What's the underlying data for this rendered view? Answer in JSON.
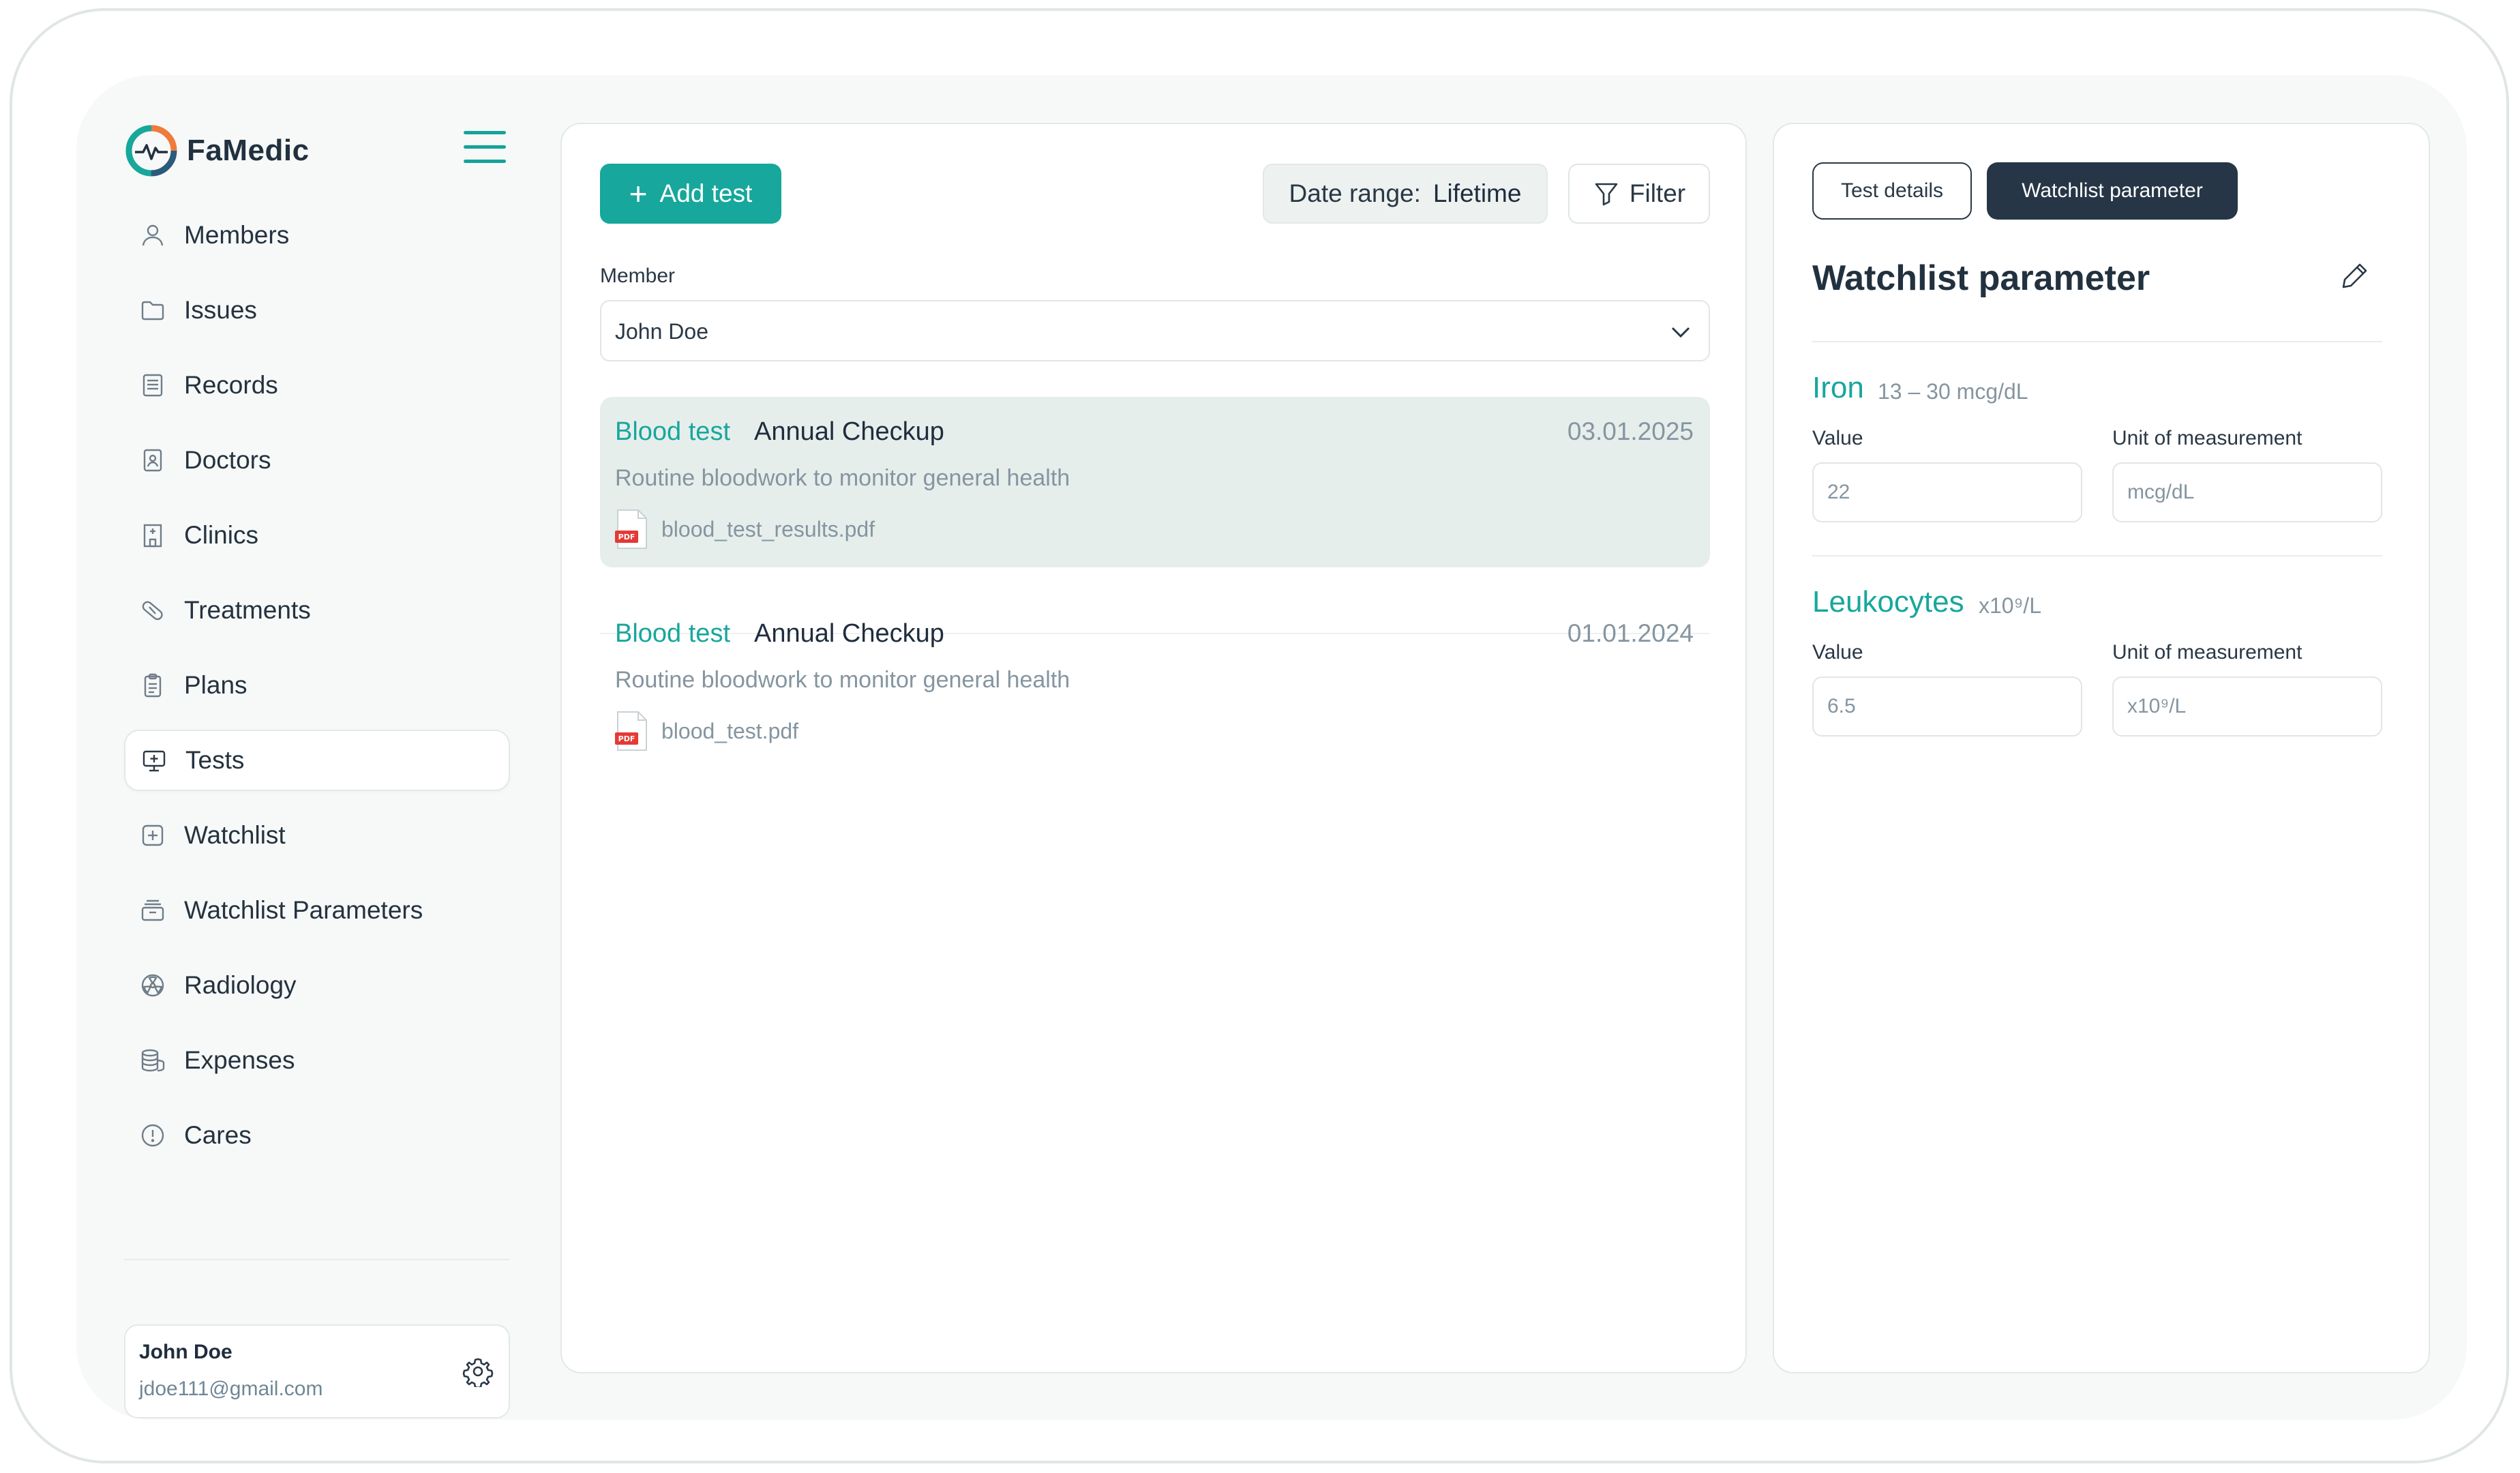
{
  "app": {
    "name": "FaMedic"
  },
  "sidebar": {
    "items": [
      {
        "label": "Members",
        "icon": "user-icon"
      },
      {
        "label": "Issues",
        "icon": "folder-icon"
      },
      {
        "label": "Records",
        "icon": "document-icon"
      },
      {
        "label": "Doctors",
        "icon": "doctor-badge-icon"
      },
      {
        "label": "Clinics",
        "icon": "hospital-icon"
      },
      {
        "label": "Treatments",
        "icon": "pill-icon"
      },
      {
        "label": "Plans",
        "icon": "clipboard-icon"
      },
      {
        "label": "Tests",
        "icon": "monitor-plus-icon",
        "active": true
      },
      {
        "label": "Watchlist",
        "icon": "watchlist-icon"
      },
      {
        "label": "Watchlist Parameters",
        "icon": "archive-icon"
      },
      {
        "label": "Radiology",
        "icon": "radiation-icon"
      },
      {
        "label": "Expenses",
        "icon": "coins-icon"
      },
      {
        "label": "Cares",
        "icon": "alert-circle-icon"
      }
    ],
    "user": {
      "name": "John Doe",
      "email": "jdoe111@gmail.com"
    }
  },
  "toolbar": {
    "add_label": "Add test",
    "date_range_label": "Date range:",
    "date_range_value": "Lifetime",
    "filter_label": "Filter"
  },
  "member": {
    "label": "Member",
    "selected": "John Doe"
  },
  "tests": [
    {
      "type": "Blood test",
      "name": "Annual Checkup",
      "date": "03.01.2025",
      "description": "Routine bloodwork to monitor general health",
      "file": "blood_test_results.pdf",
      "selected": true
    },
    {
      "type": "Blood test",
      "name": "Annual Checkup",
      "date": "01.01.2024",
      "description": "Routine bloodwork to monitor general health",
      "file": "blood_test.pdf",
      "selected": false
    }
  ],
  "details": {
    "tabs": {
      "details": "Test details",
      "watchlist": "Watchlist parameter"
    },
    "title": "Watchlist parameter",
    "value_label": "Value",
    "unit_label": "Unit of measurement",
    "params": [
      {
        "name": "Iron",
        "range": "13 – 30  mcg/dL",
        "value": "22",
        "unit": "mcg/dL"
      },
      {
        "name": "Leukocytes",
        "range": "x10⁹/L",
        "value": "6.5",
        "unit": "x10⁹/L"
      }
    ]
  },
  "colors": {
    "accent": "#17a79c",
    "dark": "#263646",
    "selected_row": "#e6eeec",
    "muted_text": "#8595a0"
  }
}
